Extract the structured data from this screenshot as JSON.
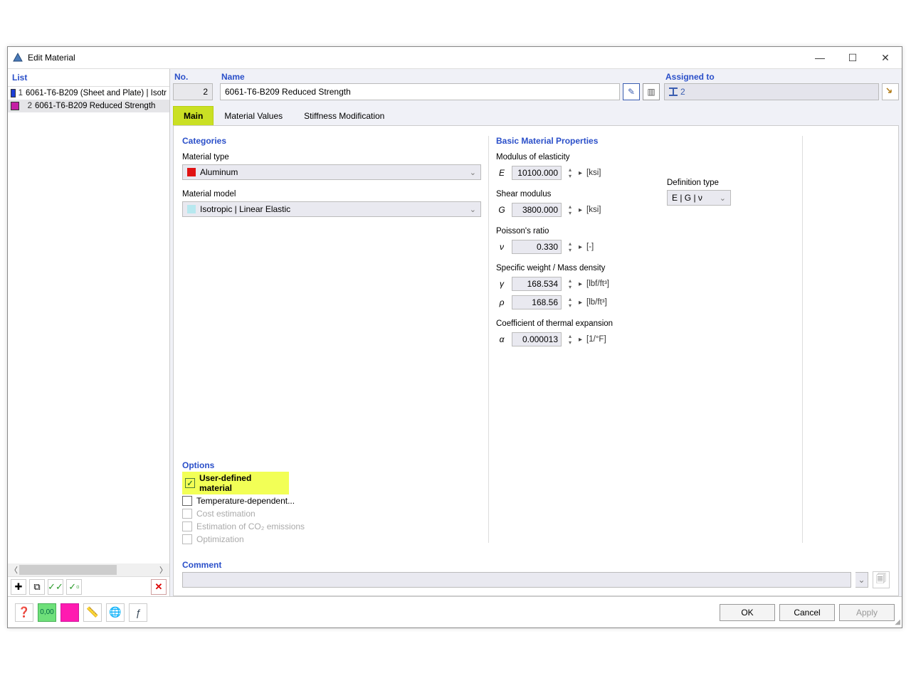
{
  "window": {
    "title": "Edit Material"
  },
  "left": {
    "header": "List",
    "items": [
      {
        "idx": "1",
        "color": "#1e3fd6",
        "name": "6061-T6-B209 (Sheet and Plate) | Isotr"
      },
      {
        "idx": "2",
        "color": "#c41fa4",
        "name": "6061-T6-B209 Reduced Strength",
        "selected": true
      }
    ]
  },
  "header_fields": {
    "no_label": "No.",
    "no_value": "2",
    "name_label": "Name",
    "name_value": "6061-T6-B209 Reduced Strength",
    "assigned_label": "Assigned to",
    "assigned_value": "2"
  },
  "tabs": {
    "main": "Main",
    "values": "Material Values",
    "stiff": "Stiffness Modification"
  },
  "categories": {
    "title": "Categories",
    "type_label": "Material type",
    "type_value": "Aluminum",
    "type_color": "#e01212",
    "model_label": "Material model",
    "model_value": "Isotropic | Linear Elastic",
    "model_color": "#b7e8ef"
  },
  "options": {
    "title": "Options",
    "user_def": "User-defined material",
    "temp_dep": "Temperature-dependent...",
    "cost": "Cost estimation",
    "co2": "Estimation of CO₂ emissions",
    "opt": "Optimization"
  },
  "basic": {
    "title": "Basic Material Properties",
    "E_label": "Modulus of elasticity",
    "E_sym": "E",
    "E_val": "10100.000",
    "E_unit": "[ksi]",
    "G_label": "Shear modulus",
    "G_sym": "G",
    "G_val": "3800.000",
    "G_unit": "[ksi]",
    "nu_label": "Poisson's ratio",
    "nu_sym": "ν",
    "nu_val": "0.330",
    "nu_unit": "[-]",
    "sw_label": "Specific weight / Mass density",
    "g_sym": "γ",
    "g_val": "168.534",
    "g_unit": "[lbf/ft³]",
    "rho_sym": "ρ",
    "rho_val": "168.56",
    "rho_unit": "[lb/ft³]",
    "a_label": "Coefficient of thermal expansion",
    "a_sym": "α",
    "a_val": "0.000013",
    "a_unit": "[1/°F]",
    "def_label": "Definition type",
    "def_val": "E | G | ν"
  },
  "comment": {
    "label": "Comment",
    "value": ""
  },
  "buttons": {
    "ok": "OK",
    "cancel": "Cancel",
    "apply": "Apply"
  }
}
